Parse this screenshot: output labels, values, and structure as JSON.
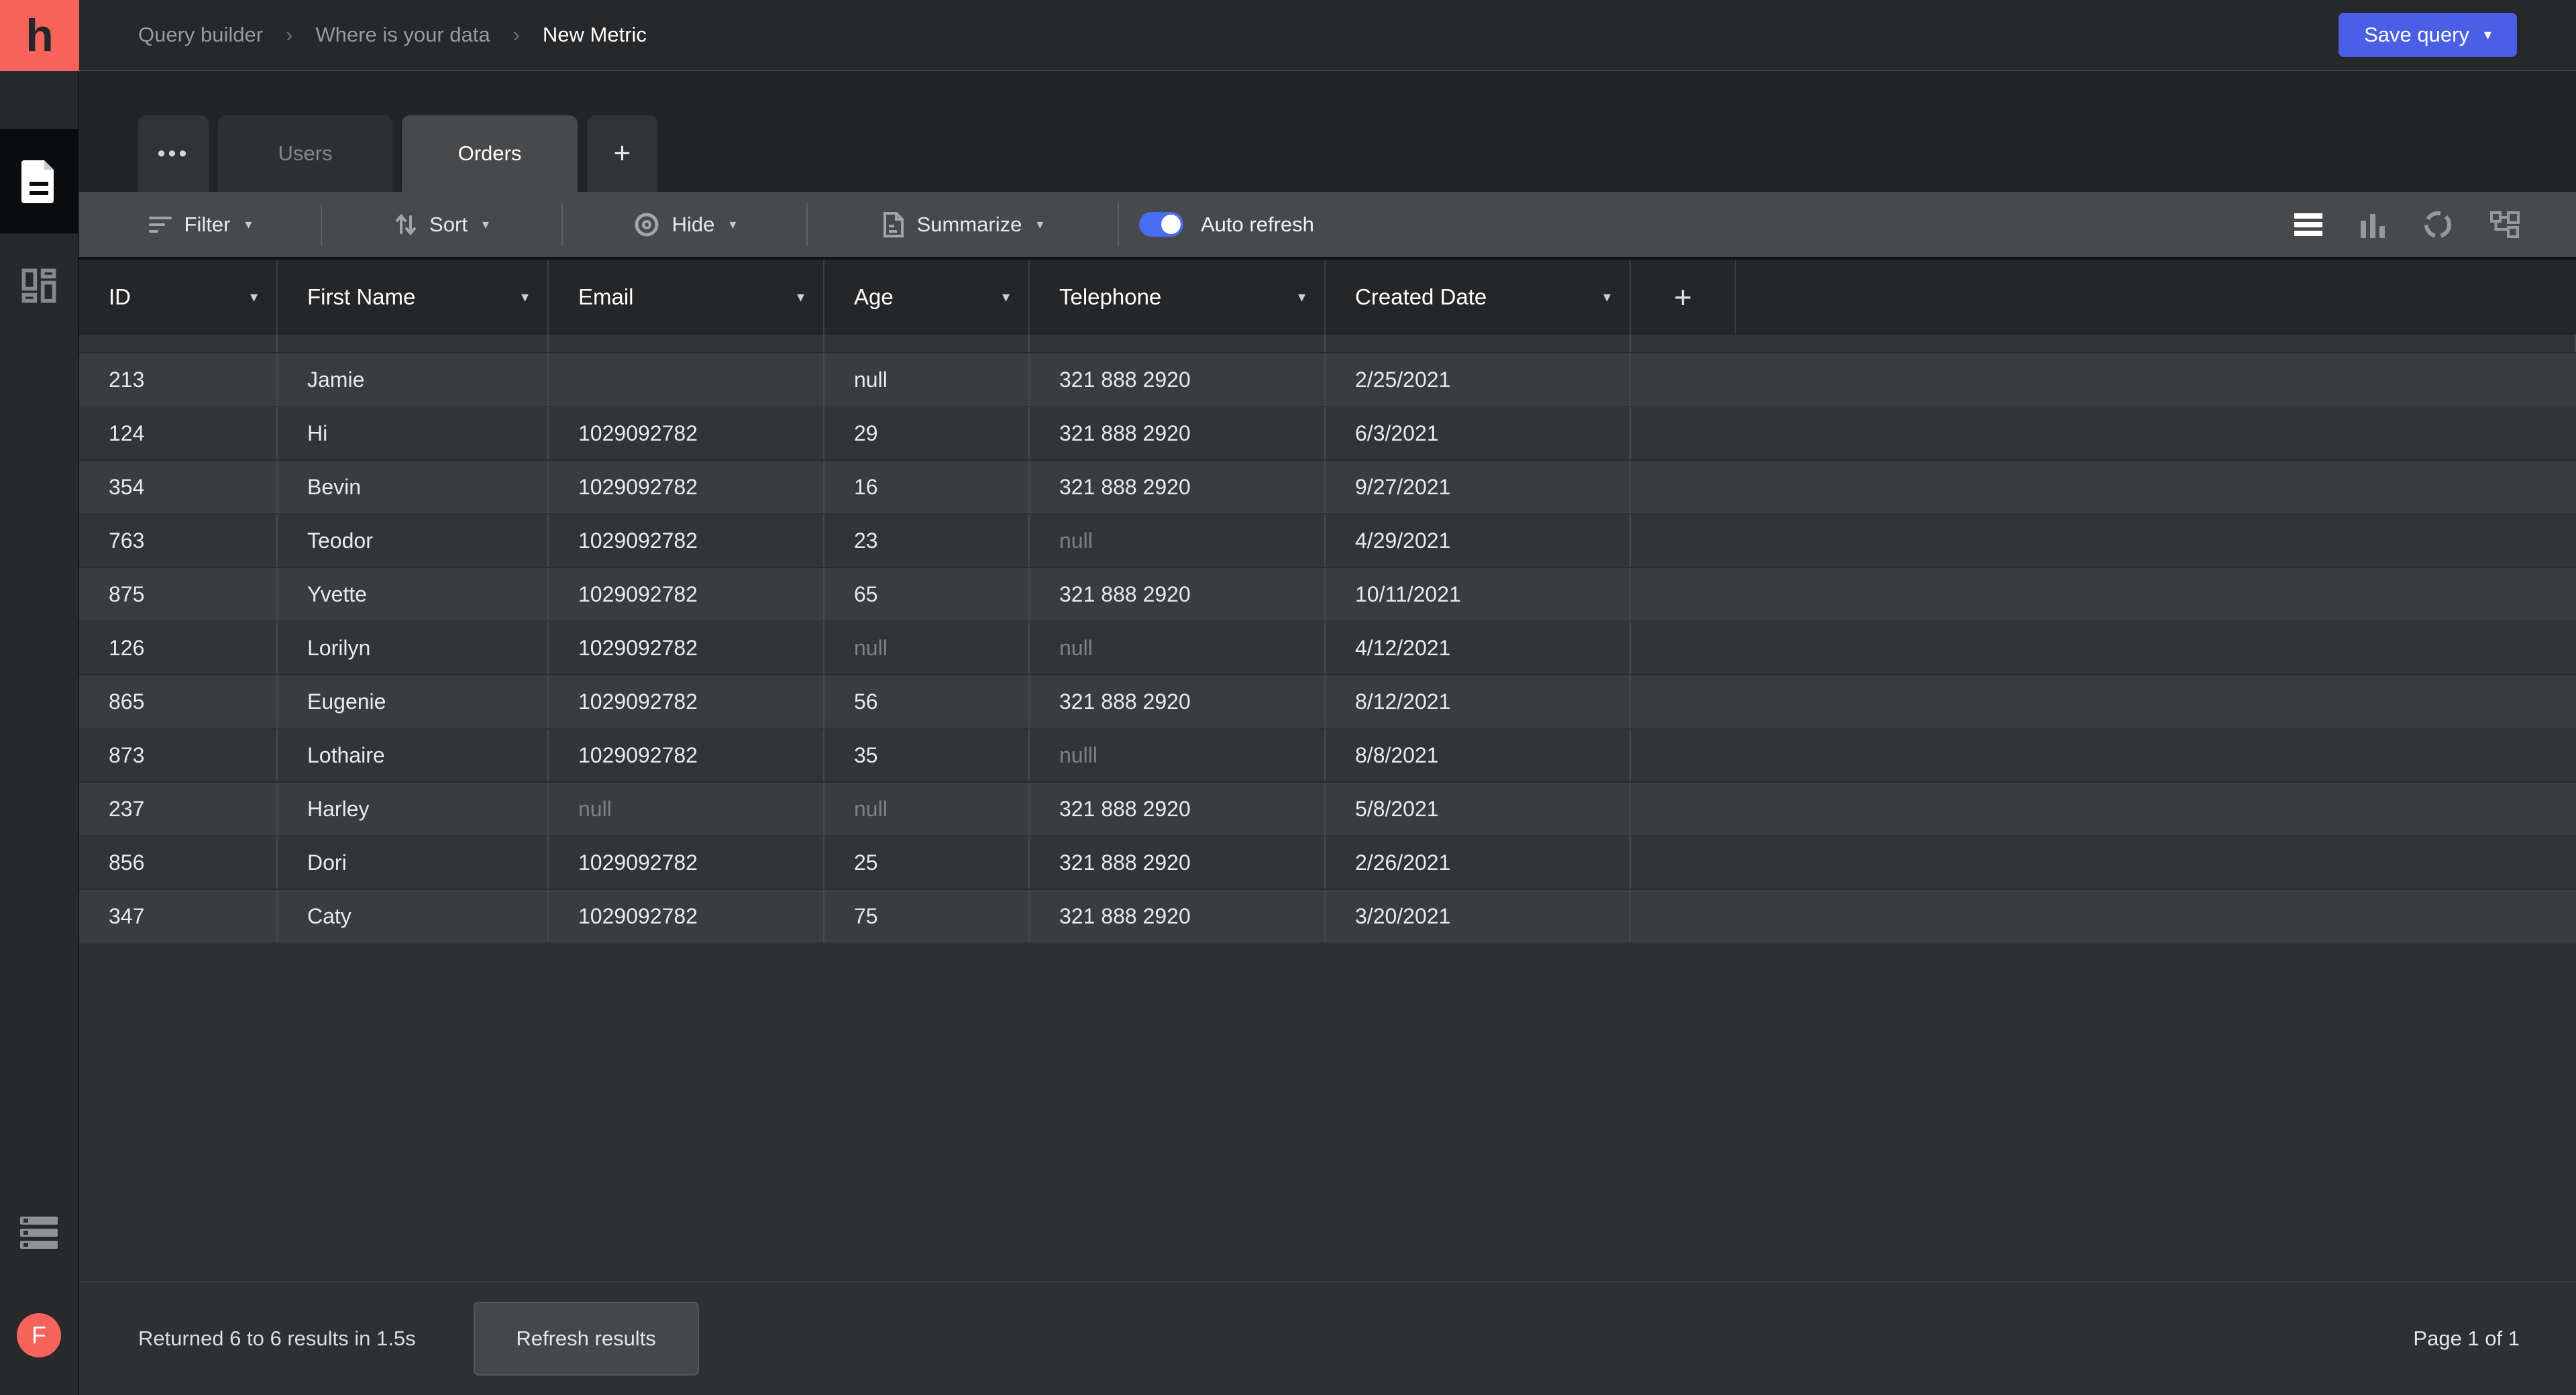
{
  "topbar": {
    "breadcrumbs": [
      "Query builder",
      "Where is your data",
      "New Metric"
    ],
    "save_button_label": "Save query"
  },
  "sidebar": {
    "logo_letter": "h",
    "items": [
      {
        "icon": "document-icon",
        "active": true
      },
      {
        "icon": "dashboard-grid-icon",
        "active": false
      },
      {
        "icon": "queue-list-icon",
        "active": false
      }
    ],
    "avatar_letter": "F"
  },
  "tabs": {
    "overflow_label": "•••",
    "items": [
      {
        "label": "Users",
        "active": false
      },
      {
        "label": "Orders",
        "active": true
      }
    ],
    "add_label": "+"
  },
  "toolbar": {
    "filter_label": "Filter",
    "sort_label": "Sort",
    "hide_label": "Hide",
    "summarize_label": "Summarize",
    "auto_refresh_label": "Auto refresh",
    "auto_refresh_on": true,
    "view_icons": [
      "table-view-icon",
      "bar-chart-icon",
      "donut-chart-icon",
      "schema-graph-icon"
    ],
    "active_view": "table-view-icon"
  },
  "grid": {
    "columns": [
      "ID",
      "First Name",
      "Email",
      "Age",
      "Telephone",
      "Created Date"
    ],
    "add_column_label": "+",
    "rows": [
      [
        "213",
        "Jamie",
        "",
        "null",
        "321 888 2920",
        "2/25/2021"
      ],
      [
        "124",
        "Hi",
        "1029092782",
        "29",
        "321 888 2920",
        "6/3/2021"
      ],
      [
        "354",
        "Bevin",
        "1029092782",
        "16",
        "321 888 2920",
        "9/27/2021"
      ],
      [
        "763",
        "Teodor",
        "1029092782",
        "23",
        {
          "v": "null",
          "muted": true
        },
        "4/29/2021"
      ],
      [
        "875",
        "Yvette",
        "1029092782",
        "65",
        "321 888 2920",
        "10/11/2021"
      ],
      [
        "126",
        "Lorilyn",
        "1029092782",
        {
          "v": "null",
          "muted": true
        },
        {
          "v": "null",
          "muted": true
        },
        "4/12/2021"
      ],
      [
        "865",
        "Eugenie",
        "1029092782",
        "56",
        "321 888 2920",
        "8/12/2021"
      ],
      [
        "873",
        "Lothaire",
        "1029092782",
        "35",
        {
          "v": "nulll",
          "muted": true
        },
        "8/8/2021"
      ],
      [
        "237",
        "Harley",
        {
          "v": "null",
          "muted": true
        },
        {
          "v": "null",
          "muted": true
        },
        "321 888 2920",
        "5/8/2021"
      ],
      [
        "856",
        "Dori",
        "1029092782",
        "25",
        "321 888 2920",
        "2/26/2021"
      ],
      [
        "347",
        "Caty",
        "1029092782",
        "75",
        "321 888 2920",
        "3/20/2021"
      ]
    ]
  },
  "footer": {
    "status_text": "Returned 6 to 6 results in 1.5s",
    "refresh_button_label": "Refresh results",
    "page_indicator": "Page 1 of 1"
  },
  "colors": {
    "brand_red": "#f8635c",
    "accent_blue": "#4a5fe6",
    "toggle_blue": "#4a6cf2",
    "row_light": "#3a3c3e",
    "row_dark": "#323437",
    "muted_text": "#7e8083"
  }
}
